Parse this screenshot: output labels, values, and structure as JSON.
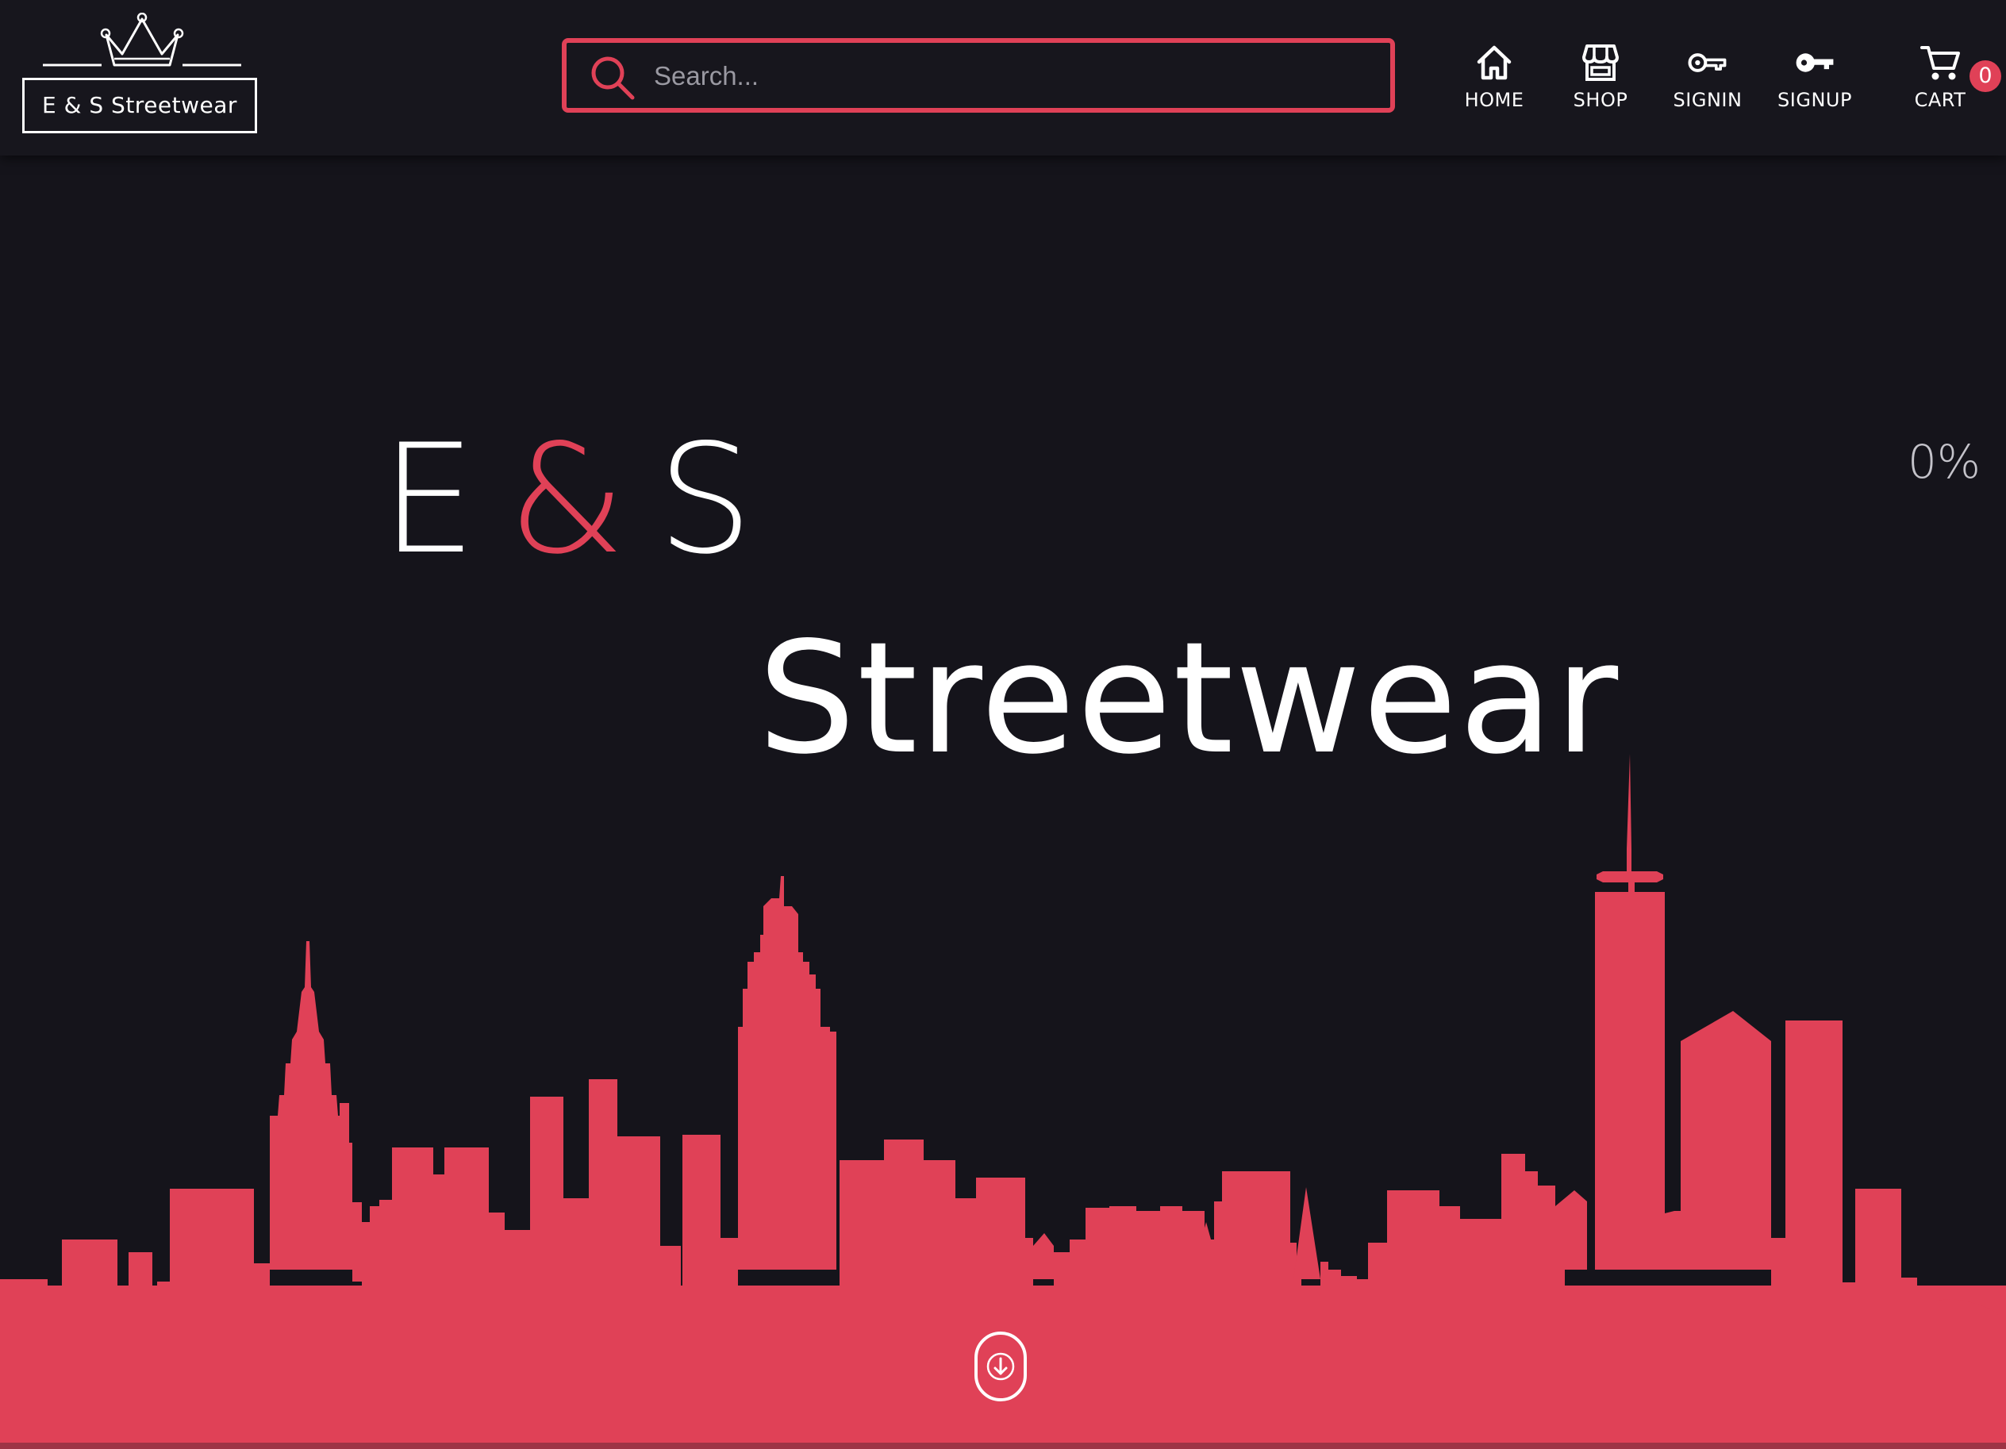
{
  "header": {
    "logo_text": "E & S Streetwear",
    "search": {
      "placeholder": "Search...",
      "value": ""
    },
    "nav": [
      {
        "label": "HOME",
        "icon": "home-icon"
      },
      {
        "label": "SHOP",
        "icon": "store-icon"
      },
      {
        "label": "SIGNIN",
        "icon": "key-outline-icon"
      },
      {
        "label": "SIGNUP",
        "icon": "key-icon"
      },
      {
        "label": "CART",
        "icon": "cart-icon"
      }
    ],
    "cart_count": "0"
  },
  "hero": {
    "title_part1": "E",
    "title_amp": "&",
    "title_part2": "S",
    "subtitle": "Streetwear",
    "progress": "0%"
  },
  "colors": {
    "background": "#15141b",
    "header_background": "#17161d",
    "accent": "#e04157",
    "text": "#ffffff"
  }
}
